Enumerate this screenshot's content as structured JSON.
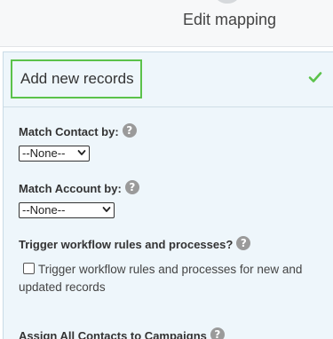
{
  "header": {
    "step_title": "Edit mapping"
  },
  "section": {
    "title": "Add new records",
    "status_icon": "check-icon",
    "accent_color": "#5bc24a"
  },
  "fields": {
    "match_contact": {
      "label": "Match Contact by:",
      "selected": "--None--"
    },
    "match_account": {
      "label": "Match Account by:",
      "selected": "--None--"
    },
    "trigger_workflow": {
      "label": "Trigger workflow rules and processes?",
      "checkbox_label": "Trigger workflow rules and processes for new and updated records",
      "checked": false
    },
    "assign_campaigns": {
      "label": "Assign All Contacts to Campaigns"
    }
  },
  "help_glyph": "?"
}
